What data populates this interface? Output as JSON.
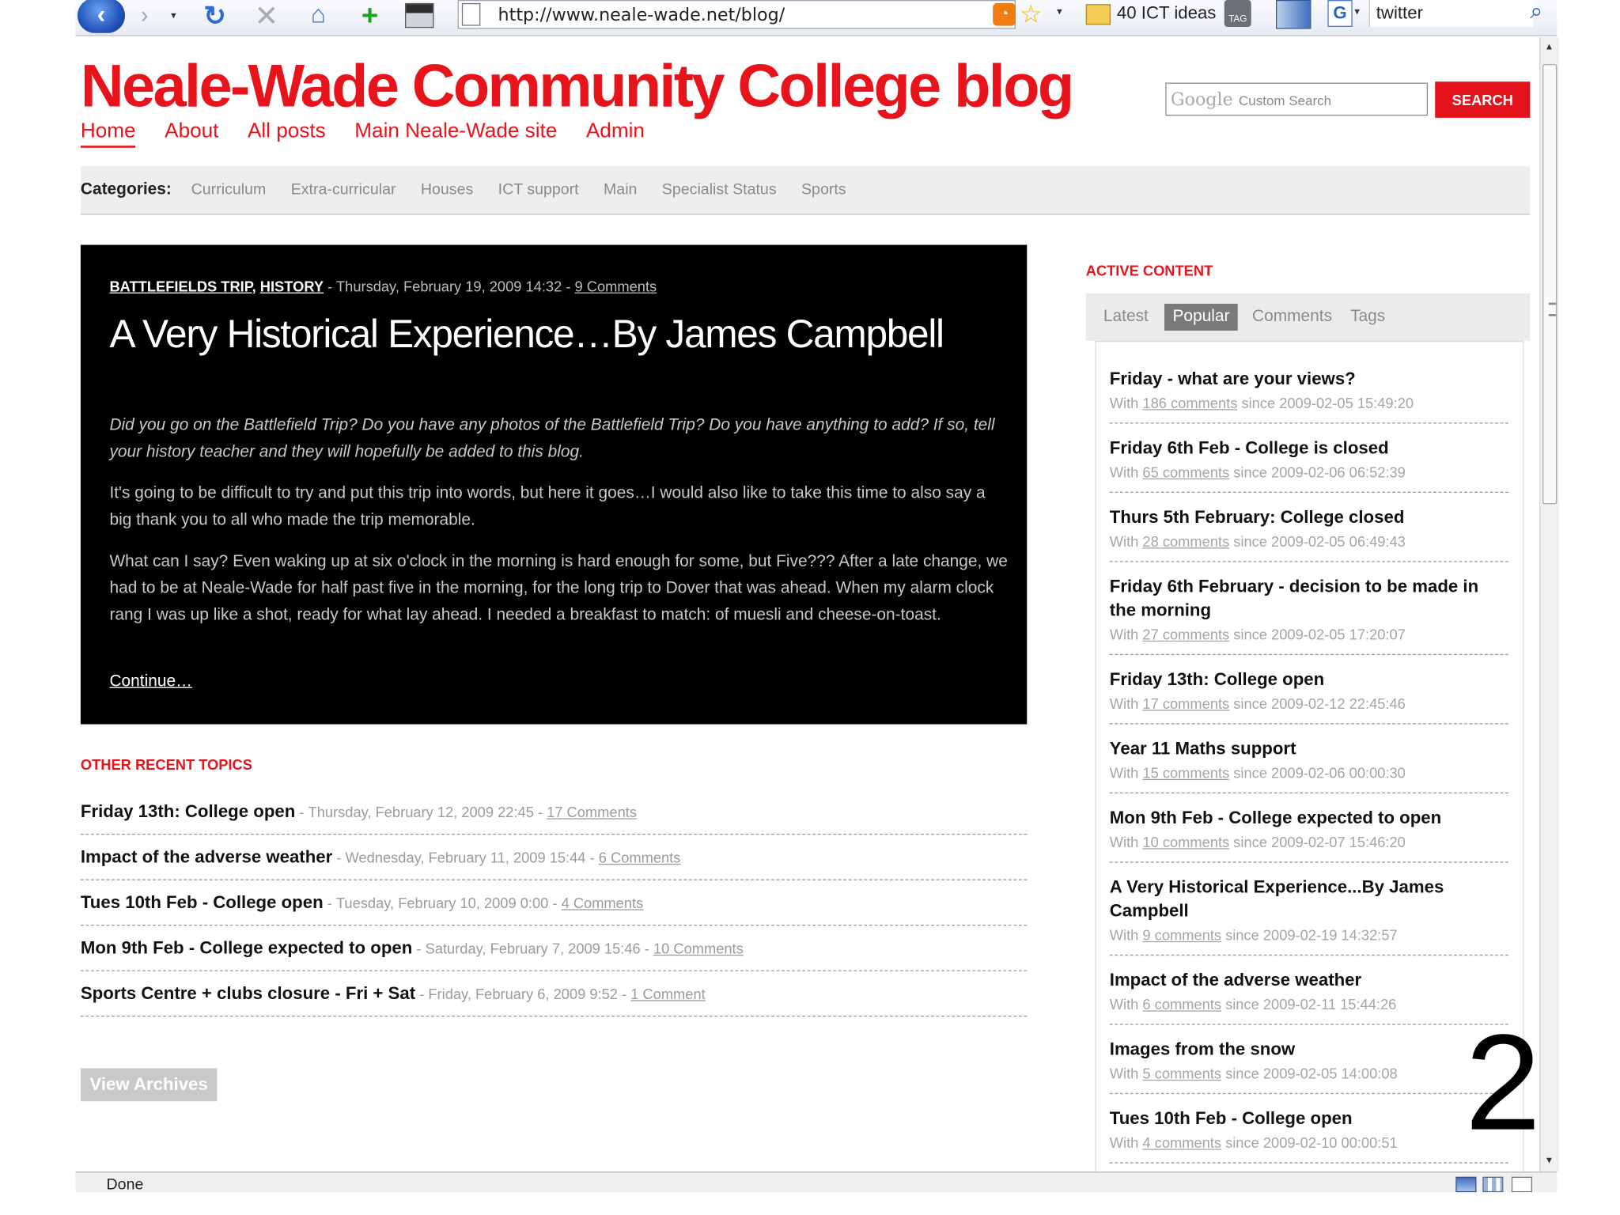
{
  "browser": {
    "url": "http://www.neale-wade.net/blog/",
    "bookmark_folder": "40 ICT ideas",
    "tag_icon_label": "TAG",
    "search_engine_letter": "G",
    "search_value": "twitter",
    "status": "Done",
    "icons": [
      "back-arrow-icon",
      "forward-arrow-icon",
      "reload-icon",
      "stop-icon",
      "home-icon",
      "add-bookmark-icon",
      "screenshot-icon",
      "page-icon",
      "rss-feed-icon",
      "star-icon",
      "folder-icon",
      "tag-icon",
      "search-magnifier-icon"
    ]
  },
  "site": {
    "title": "Neale-Wade Community College blog",
    "nav": [
      "Home",
      "About",
      "All posts",
      "Main Neale-Wade site",
      "Admin"
    ],
    "search_logo": "Google",
    "search_placeholder": "Custom Search",
    "search_button": "SEARCH",
    "accent_color": "#e8141b"
  },
  "categories": {
    "label": "Categories:",
    "items": [
      "Curriculum",
      "Extra-curricular",
      "Houses",
      "ICT support",
      "Main",
      "Specialist Status",
      "Sports"
    ]
  },
  "featured": {
    "tag1": "BATTLEFIELDS TRIP",
    "tag_sep": ", ",
    "tag2": "HISTORY",
    "date": " - Thursday, February 19, 2009 14:32 - ",
    "comments": "9 Comments",
    "title": "A Very Historical Experience…By James Campbell",
    "intro": "Did you go on the Battlefield Trip? Do you have any photos of the Battlefield Trip? Do you have anything to add? If so, tell your history teacher and they will hopefully be added to this blog.",
    "para1": "It's going to be difficult to try and put this trip into words, but here it goes…I would also like to take this time to also say a big thank you to all who made the trip memorable.",
    "para2": "What can I say? Even waking up at six o'clock in the morning is hard enough for some, but Five??? After a late change, we had to be at Neale-Wade for half past five in the morning, for the long trip to Dover that was ahead. When my alarm clock rang I was up like a shot, ready for what lay ahead. I needed a breakfast to match: of muesli and cheese-on-toast.",
    "more": "Continue…"
  },
  "other_topics": {
    "heading": "OTHER RECENT TOPICS",
    "items": [
      {
        "title": "Friday 13th: College open",
        "date": "Thursday, February 12, 2009 22:45",
        "comments": "17 Comments"
      },
      {
        "title": "Impact of the adverse weather",
        "date": "Wednesday, February 11, 2009 15:44",
        "comments": "6 Comments"
      },
      {
        "title": "Tues 10th Feb - College open",
        "date": "Tuesday, February 10, 2009 0:00",
        "comments": "4 Comments"
      },
      {
        "title": "Mon 9th Feb - College expected to open",
        "date": "Saturday, February 7, 2009 15:46",
        "comments": "10 Comments"
      },
      {
        "title": "Sports Centre + clubs closure - Fri + Sat",
        "date": "Friday, February 6, 2009 9:52",
        "comments": "1 Comment"
      }
    ],
    "archives_button": "View Archives"
  },
  "sidebar": {
    "heading": "ACTIVE CONTENT",
    "tabs": [
      "Latest",
      "Popular",
      "Comments",
      "Tags"
    ],
    "active_tab": "Popular",
    "items": [
      {
        "title": "Friday - what are your views?",
        "count": "186 comments",
        "since": "2009-02-05 15:49:20"
      },
      {
        "title": "Friday 6th Feb - College is closed",
        "count": "65 comments",
        "since": "2009-02-06 06:52:39"
      },
      {
        "title": "Thurs 5th February: College closed",
        "count": "28 comments",
        "since": "2009-02-05 06:49:43"
      },
      {
        "title": "Friday 6th February - decision to be made in the morning",
        "count": "27 comments",
        "since": "2009-02-05 17:20:07"
      },
      {
        "title": "Friday 13th: College open",
        "count": "17 comments",
        "since": "2009-02-12 22:45:46"
      },
      {
        "title": "Year 11 Maths support",
        "count": "15 comments",
        "since": "2009-02-06 00:00:30"
      },
      {
        "title": "Mon 9th Feb - College expected to open",
        "count": "10 comments",
        "since": "2009-02-07 15:46:20"
      },
      {
        "title": "A Very Historical Experience...By James Campbell",
        "count": "9 comments",
        "since": "2009-02-19 14:32:57"
      },
      {
        "title": "Impact of the adverse weather",
        "count": "6 comments",
        "since": "2009-02-11 15:44:26"
      },
      {
        "title": "Images from the snow",
        "count": "5 comments",
        "since": "2009-02-05 14:00:08"
      },
      {
        "title": "Tues 10th Feb - College open",
        "count": "4 comments",
        "since": "2009-02-10 00:00:51"
      }
    ]
  },
  "slide_number": "2"
}
